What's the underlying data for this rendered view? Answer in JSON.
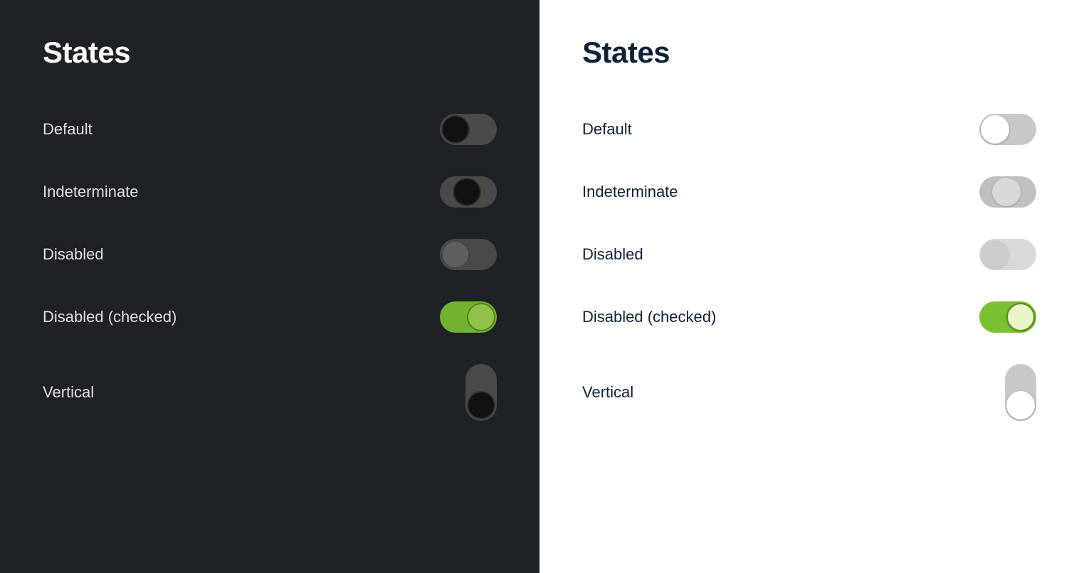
{
  "panels": {
    "dark": {
      "title": "States",
      "states": [
        {
          "label": "Default",
          "type": "toggle-default-dark"
        },
        {
          "label": "Indeterminate",
          "type": "toggle-indeterminate-dark"
        },
        {
          "label": "Disabled",
          "type": "toggle-disabled-dark"
        },
        {
          "label": "Disabled (checked)",
          "type": "toggle-disabled-checked-dark"
        },
        {
          "label": "Vertical",
          "type": "toggle-vertical-dark"
        }
      ]
    },
    "light": {
      "title": "States",
      "states": [
        {
          "label": "Default",
          "type": "toggle-default-light"
        },
        {
          "label": "Indeterminate",
          "type": "toggle-indeterminate-light"
        },
        {
          "label": "Disabled",
          "type": "toggle-disabled-light"
        },
        {
          "label": "Disabled (checked)",
          "type": "toggle-disabled-checked-light"
        },
        {
          "label": "Vertical",
          "type": "toggle-vertical-light"
        }
      ]
    }
  },
  "colors": {
    "dark_bg": "#1e2126",
    "light_bg": "#ffffff",
    "green": "#7ac231",
    "dark_text": "#0d2137"
  }
}
